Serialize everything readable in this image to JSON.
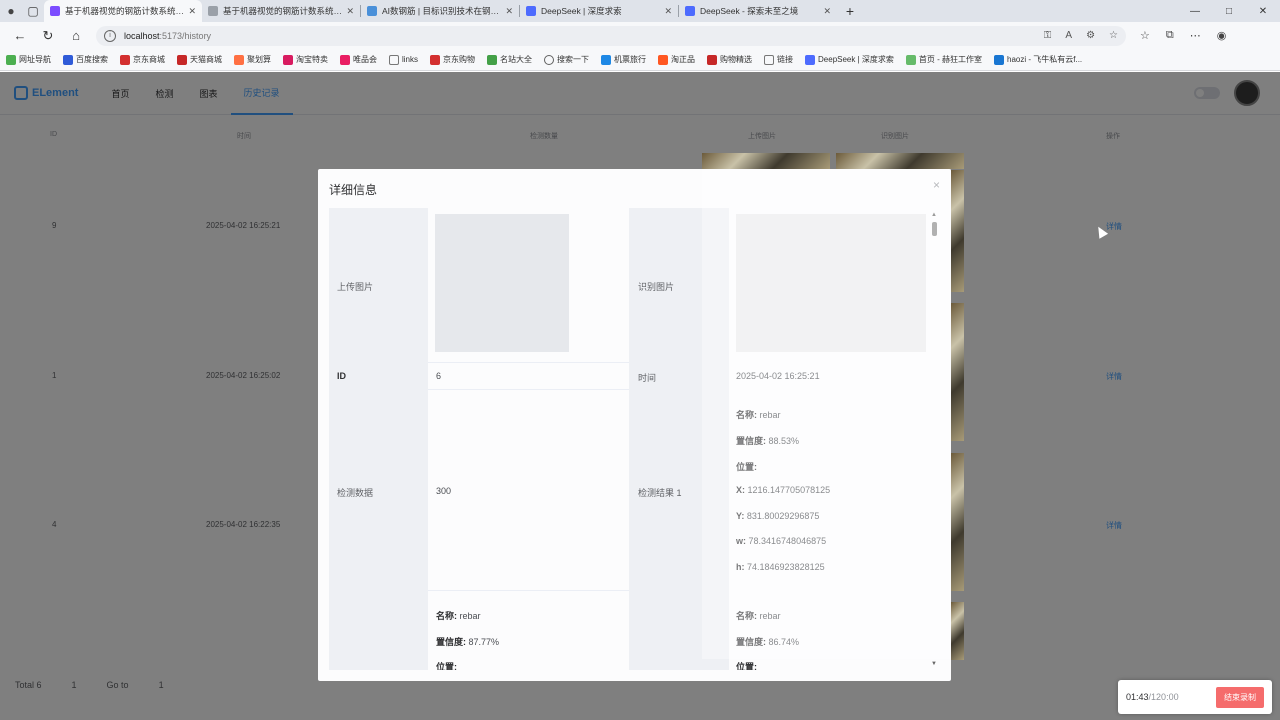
{
  "browser": {
    "tabs": [
      {
        "title": "基于机器视觉的钢筋计数系统算法",
        "active": true,
        "color": "#7c4dff"
      },
      {
        "title": "基于机器视觉的钢筋计数系统算法",
        "active": false,
        "color": "#9aa0a8"
      },
      {
        "title": "AI数钢筋 | 目标识别技术在钢筋计",
        "active": false,
        "color": "#4a90d9"
      },
      {
        "title": "DeepSeek | 深度求索",
        "active": false,
        "color": "#4d6bfe"
      },
      {
        "title": "DeepSeek - 探索未至之境",
        "active": false,
        "color": "#4d6bfe"
      }
    ],
    "new_tab": "+",
    "window_controls": [
      "—",
      "□",
      "✕"
    ],
    "url_host": "localhost",
    "url_path": ":5173/history",
    "bookmarks": [
      {
        "label": "网址导航",
        "color": "#4caf50"
      },
      {
        "label": "百度搜索",
        "color": "#2f5bd8"
      },
      {
        "label": "京东商城",
        "color": "#d32f2f"
      },
      {
        "label": "天猫商城",
        "color": "#c62828"
      },
      {
        "label": "聚划算",
        "color": "#ff7043"
      },
      {
        "label": "淘宝特卖",
        "color": "#d81b60"
      },
      {
        "label": "唯品会",
        "color": "#e91e63"
      },
      {
        "label": "links",
        "color": "#777777"
      },
      {
        "label": "京东购物",
        "color": "#d32f2f"
      },
      {
        "label": "名站大全",
        "color": "#43a047"
      },
      {
        "label": "搜索一下",
        "color": "#616161"
      },
      {
        "label": "机票旅行",
        "color": "#1e88e5"
      },
      {
        "label": "淘正品",
        "color": "#ff5722"
      },
      {
        "label": "购物精选",
        "color": "#c62828"
      },
      {
        "label": "链接",
        "color": "#777777"
      },
      {
        "label": "DeepSeek | 深度求索",
        "color": "#4d6bfe"
      },
      {
        "label": "首页 - 赫狂工作室",
        "color": "#66bb6a"
      },
      {
        "label": "haozi - 飞牛私有云f...",
        "color": "#1976d2"
      }
    ]
  },
  "app": {
    "logo": "ELement",
    "nav": [
      "首页",
      "检测",
      "图表",
      "历史记录"
    ],
    "table_headers": [
      "ID",
      "时间",
      "检测数量",
      "上传图片",
      "识别图片",
      "操作"
    ],
    "rows": [
      {
        "id": "9",
        "time": "2025-04-02 16:25:21",
        "op": "详情"
      },
      {
        "id": "1",
        "time": "2025-04-02 16:25:02",
        "op": "详情"
      },
      {
        "id": "4",
        "time": "2025-04-02 16:22:35",
        "op": "详情"
      }
    ],
    "pager": {
      "total": "Total 6",
      "page": "1",
      "goto": "Go to",
      "goto_val": "1"
    }
  },
  "dialog": {
    "title": "详细信息",
    "close": "×",
    "labels": {
      "upload": "上传图片",
      "recog": "识别图片",
      "id": "ID",
      "time": "时间",
      "count": "检测数据",
      "result1": "检测结果 1"
    },
    "id_value": "6",
    "time_value": "2025-04-02 16:25:21",
    "count_value": "300",
    "result1": {
      "name_label": "名称:",
      "name": "rebar",
      "conf_label": "置信度:",
      "conf": "88.53%",
      "pos_label": "位置:",
      "x_label": "X:",
      "x": "1216.147705078125",
      "y_label": "Y:",
      "y": "831.80029296875",
      "w_label": "w:",
      "w": "78.3416748046875",
      "h_label": "h:",
      "h": "74.1846923828125"
    },
    "result_left": {
      "name_label": "名称:",
      "name": "rebar",
      "conf_label": "置信度:",
      "conf": "87.77%",
      "pos_label": "位置:"
    },
    "result_right": {
      "name_label": "名称:",
      "name": "rebar",
      "conf_label": "置信度:",
      "conf": "86.74%",
      "pos_label": "位置:"
    }
  },
  "recorder": {
    "elapsed": "01:43",
    "sep": " / ",
    "total": "120:00",
    "stop": "结束录制"
  }
}
